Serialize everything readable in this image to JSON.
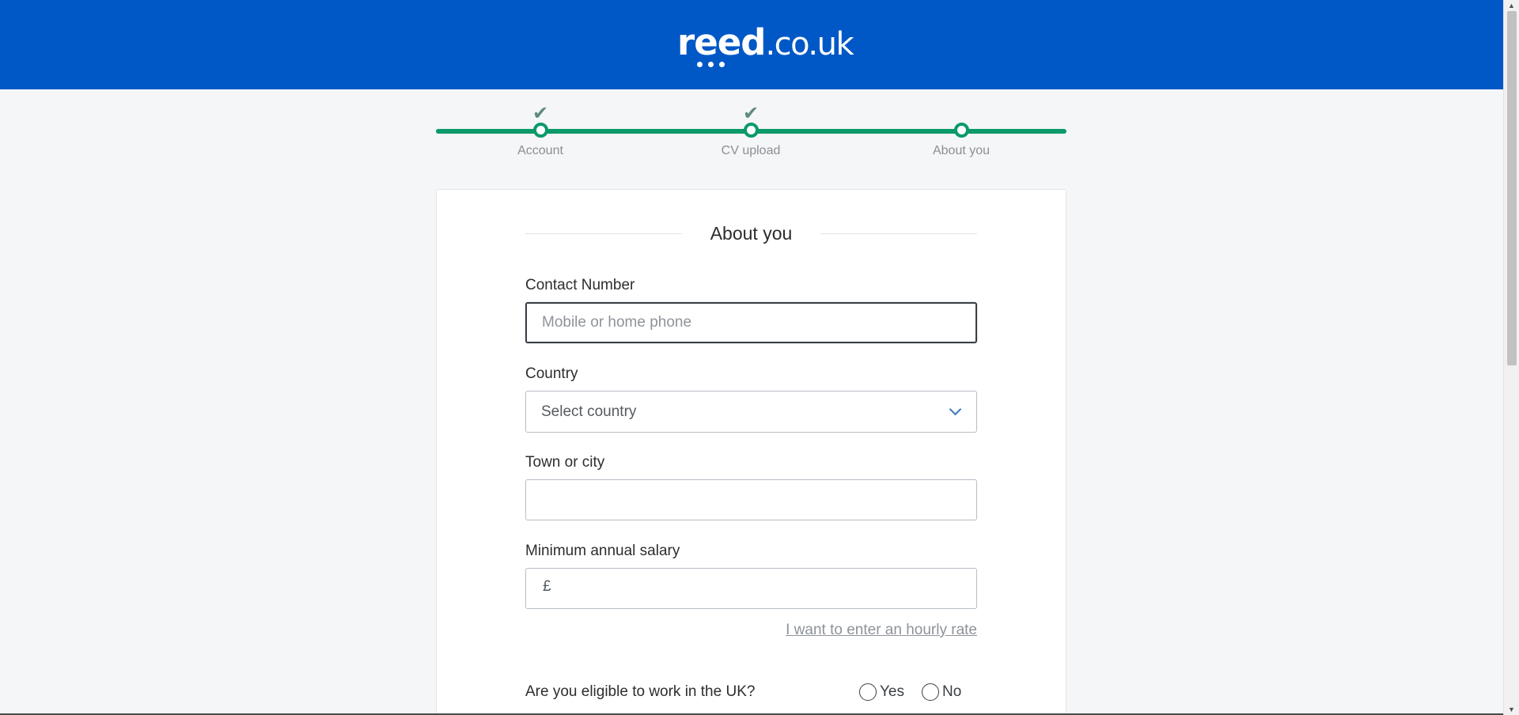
{
  "header": {
    "logo_main": "reed",
    "logo_tld": ".co.uk"
  },
  "progress": {
    "steps": [
      {
        "label": "Account",
        "completed": true
      },
      {
        "label": "CV upload",
        "completed": true
      },
      {
        "label": "About you",
        "completed": false
      }
    ],
    "check_glyph": "✔"
  },
  "form": {
    "title": "About you",
    "contact": {
      "label": "Contact Number",
      "placeholder": "Mobile or home phone",
      "value": ""
    },
    "country": {
      "label": "Country",
      "selected": "Select country"
    },
    "town": {
      "label": "Town or city",
      "value": ""
    },
    "salary": {
      "label": "Minimum annual salary",
      "currency_symbol": "£",
      "value": ""
    },
    "hourly_link": "I want to enter an hourly rate",
    "eligibility": {
      "question": "Are you eligible to work in the UK?",
      "options": [
        "Yes",
        "No"
      ]
    }
  },
  "colors": {
    "brand_blue": "#0058c6",
    "progress_green": "#0a9a6a",
    "page_bg": "#f5f6f8"
  },
  "icons": {
    "step_check": "check-icon",
    "select_arrow": "chevron-down-icon"
  }
}
